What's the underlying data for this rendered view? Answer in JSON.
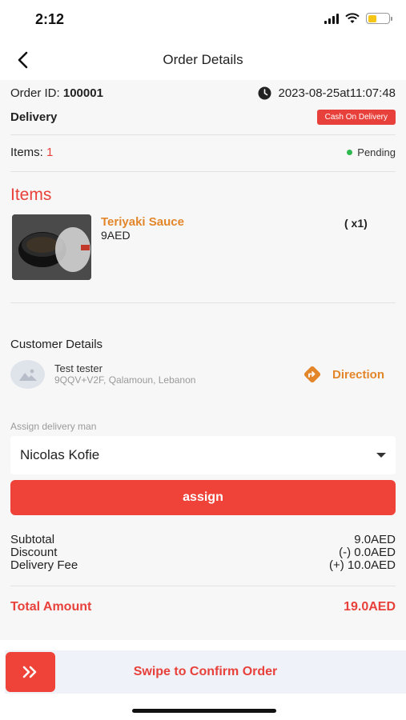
{
  "status_bar": {
    "time": "2:12"
  },
  "nav": {
    "title": "Order Details"
  },
  "order": {
    "id_label": "Order ID:",
    "id_value": "100001",
    "datetime": "2023-08-25at11:07:48",
    "type": "Delivery",
    "payment_badge": "Cash On Delivery",
    "items_label": "Items:",
    "items_count": "1",
    "status": "Pending"
  },
  "items_section": {
    "title": "Items",
    "items": [
      {
        "name": "Teriyaki Sauce",
        "price": "9AED",
        "qty": "( x1)"
      }
    ]
  },
  "customer": {
    "section_title": "Customer Details",
    "name": "Test tester",
    "address": "9QQV+V2F, Qalamoun, Lebanon",
    "direction_label": "Direction"
  },
  "assign": {
    "label": "Assign delivery man",
    "selected": "Nicolas Kofie",
    "button_label": "assign"
  },
  "summary": {
    "subtotal_label": "Subtotal",
    "subtotal_value": "9.0AED",
    "discount_label": "Discount",
    "discount_value": "(-) 0.0AED",
    "delivery_fee_label": "Delivery Fee",
    "delivery_fee_value": "(+) 10.0AED",
    "total_label": "Total Amount",
    "total_value": "19.0AED"
  },
  "swipe": {
    "text": "Swipe to Confirm Order"
  },
  "colors": {
    "accent": "#e8403a",
    "orange": "#e3862a",
    "status_green": "#2fb84f"
  }
}
